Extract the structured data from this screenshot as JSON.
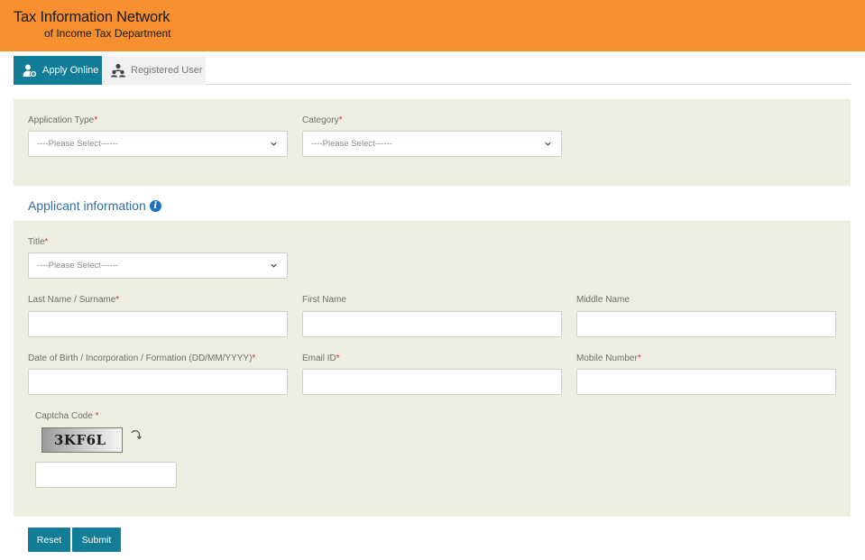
{
  "header": {
    "title": "Tax Information Network",
    "subtitle": "of Income Tax Department"
  },
  "tabs": [
    {
      "label": "Apply Online",
      "icon": "user-plus-icon",
      "active": true
    },
    {
      "label": "Registered User",
      "icon": "users-icon",
      "active": false
    }
  ],
  "form": {
    "application_type": {
      "label": "Application Type",
      "required": "*",
      "value": "----Please Select------"
    },
    "category": {
      "label": "Category",
      "required": "*",
      "value": "----Please Select------"
    },
    "applicant_section_title": "Applicant information",
    "title_field": {
      "label": "Title",
      "required": "*",
      "value": "----Please Select------"
    },
    "last_name": {
      "label": "Last Name / Surname",
      "required": "*",
      "value": ""
    },
    "first_name": {
      "label": "First Name",
      "value": ""
    },
    "middle_name": {
      "label": "Middle Name",
      "value": ""
    },
    "dob": {
      "label": "Date of Birth / Incorporation / Formation (DD/MM/YYYY)",
      "required": "*",
      "value": ""
    },
    "email": {
      "label": "Email ID",
      "required": "*",
      "value": ""
    },
    "mobile": {
      "label": "Mobile Number",
      "required": "*",
      "value": ""
    },
    "captcha": {
      "label": "Captcha Code",
      "required": " *",
      "code": "3KF6L",
      "value": ""
    }
  },
  "buttons": {
    "reset": "Reset",
    "submit": "Submit"
  },
  "colors": {
    "header": "#f68f2f",
    "accent": "#117d96",
    "panel": "#eeeee0",
    "section_title": "#2d6ea8",
    "required": "#c0392b"
  }
}
